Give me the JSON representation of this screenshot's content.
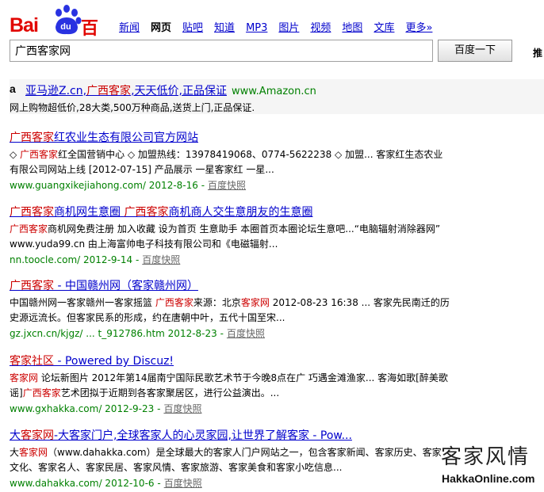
{
  "header": {
    "logo_text_left": "Bai",
    "logo_text_paw": "du",
    "logo_text_cn": "百度",
    "nav": [
      {
        "label": "新闻",
        "current": false
      },
      {
        "label": "网页",
        "current": true
      },
      {
        "label": "贴吧",
        "current": false
      },
      {
        "label": "知道",
        "current": false
      },
      {
        "label": "MP3",
        "current": false
      },
      {
        "label": "图片",
        "current": false
      },
      {
        "label": "视频",
        "current": false
      },
      {
        "label": "地图",
        "current": false
      },
      {
        "label": "文库",
        "current": false
      },
      {
        "label": "更多»",
        "current": false
      }
    ],
    "search_value": "广西客家网",
    "search_button": "百度一下",
    "advanced_label": "推"
  },
  "ad": {
    "badge": "a",
    "title_pre": "亚马逊Z.cn,",
    "title_kw": "广西客家",
    "title_post": ",天天低价,正品保证",
    "site": "www.Amazon.cn",
    "desc": "网上购物超低价,28大类,500万种商品,送货上门,正品保证."
  },
  "results": [
    {
      "title_kw": "广西客家",
      "title_rest": "红农业生态有限公司官方网站",
      "desc_1": "◇ ",
      "desc_kw": "广西客家",
      "desc_2": "红全国营销中心 ◇ 加盟热线：13978419068、0774-5622238 ◇ 加盟... 客家红生态农业有限公司网站上线 [2012-07-15] 产品展示 一星客家红 一星...",
      "url": "www.guangxikejiahong.com/ 2012-8-16 -",
      "snapshot": "百度快照"
    },
    {
      "title_kw": "广西客家",
      "title_rest": "商机网生意圈 ",
      "title_kw2": "广西客家",
      "title_rest2": "商机商人交生意朋友的生意圈",
      "desc_kw": "广西客家",
      "desc_2": "商机网免费注册 加入收藏 设为首页 生意助手 本圈首页本圈论坛生意吧...“电脑辐射消除器网” www.yuda99.cn 由上海富帅电子科技有限公司和《电磁辐射...",
      "url": "nn.toocle.com/ 2012-9-14 -",
      "snapshot": "百度快照"
    },
    {
      "title_kw": "广西客家",
      "title_rest": " - 中国赣州网（客家赣州网）",
      "desc_1": "中国赣州网一客家赣州一客家摇篮 ",
      "desc_kw": "广西客家",
      "desc_2": "来源：北京",
      "desc_kw2": "客家网",
      "desc_3": " 2012-08-23 16:38 ... 客家先民南迁的历史源远流长。但客家民系的形成，约在唐朝中叶，五代十国至宋...",
      "url": "gz.jxcn.cn/kjgz/ ... t_912786.htm 2012-8-23 -",
      "snapshot": "百度快照"
    },
    {
      "title_kw": "客家社区",
      "title_rest": " - Powered by Discuz!",
      "desc_kw": "客家网",
      "desc_2": " 论坛新图片 2012年第14届南宁国际民歌艺术节于今晚8点在广 巧遇金滩渔家... 客海如歌[醉美歌谣]",
      "desc_kw2": "广西客家",
      "desc_3": "艺术团拟于近期到各客家聚居区，进行公益演出。...",
      "url": "www.gxhakka.com/ 2012-9-23 -",
      "snapshot": "百度快照"
    },
    {
      "title_pre": "大",
      "title_kw": "客家网",
      "title_rest": "-大客家门户,全球客家人的心灵家园,让世界了解客家 - Pow...",
      "desc_1": "大",
      "desc_kw": "客家网",
      "desc_2": "（www.dahakka.com）是全球最大的客家人门户网站之一，包含客家新闻、客家历史、客家文化、客家名人、客家民居、客家风情、客家旅游、客家美食和客家小吃信息...",
      "url": "www.dahakka.com/ 2012-10-6 -",
      "snapshot": "百度快照"
    }
  ],
  "watermark": {
    "calligraphy": "客家风情",
    "site": "HakkaOnline.com"
  }
}
